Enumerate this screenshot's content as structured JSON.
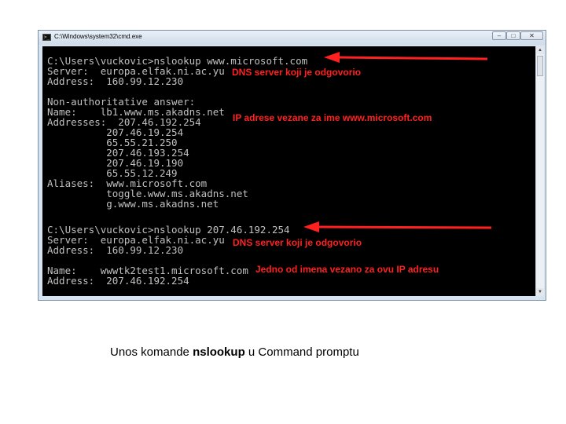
{
  "window": {
    "title": "C:\\Windows\\system32\\cmd.exe",
    "icon": "cmd-icon",
    "minimize": "–",
    "maximize": "□",
    "close": "✕"
  },
  "console_lines": [
    "C:\\Users\\vuckovic>nslookup www.microsoft.com",
    "Server:  europa.elfak.ni.ac.yu",
    "Address:  160.99.12.230",
    "Non-authoritative answer:",
    "Name:    lb1.www.ms.akadns.net",
    "Addresses:  207.46.192.254",
    "          207.46.19.254",
    "          65.55.21.250",
    "          207.46.193.254",
    "          207.46.19.190",
    "          65.55.12.249",
    "Aliases:  www.microsoft.com",
    "          toggle.www.ms.akadns.net",
    "          g.www.ms.akadns.net",
    "C:\\Users\\vuckovic>nslookup 207.46.192.254",
    "Server:  europa.elfak.ni.ac.yu",
    "Address:  160.99.12.230",
    "Name:    wwwtk2test1.microsoft.com",
    "Address:  207.46.192.254"
  ],
  "annotations": {
    "dns_server_1": "DNS server koji je odgovorio",
    "ip_addresses": "IP adrese vezane za ime www.microsoft.com",
    "dns_server_2": "DNS server koji je odgovorio",
    "one_name": "Jedno od imena vezano za ovu IP adresu",
    "color": "#ff2020"
  },
  "caption": {
    "prefix": "Unos komande ",
    "command": "nslookup",
    "suffix": " u Command promptu"
  }
}
